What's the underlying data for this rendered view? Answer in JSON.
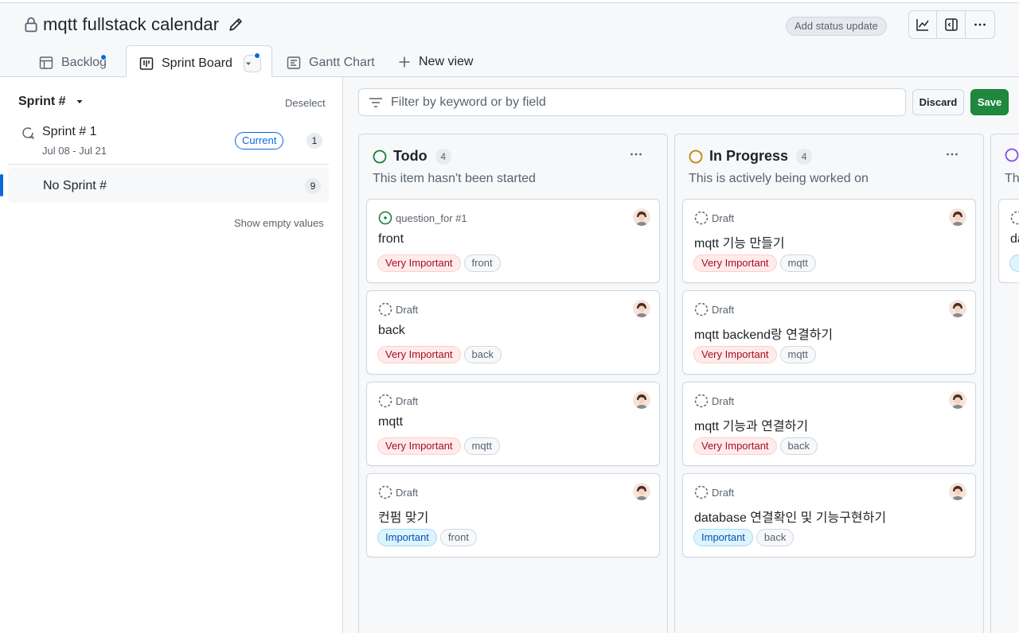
{
  "project": {
    "title": "mqtt fullstack calendar"
  },
  "header": {
    "status_button": "Add status update"
  },
  "tabs": [
    {
      "label": "Backlog"
    },
    {
      "label": "Sprint Board"
    },
    {
      "label": "Gantt Chart"
    },
    {
      "label": "New view"
    }
  ],
  "sidebar": {
    "field_label": "Sprint #",
    "deselect": "Deselect",
    "sprint": {
      "name": "Sprint # 1",
      "dates": "Jul 08 - Jul 21",
      "badge": "Current",
      "count": "1"
    },
    "no_sprint": {
      "name": "No Sprint #",
      "count": "9"
    },
    "show_empty": "Show empty values"
  },
  "filter": {
    "placeholder": "Filter by keyword or by field",
    "discard": "Discard",
    "save": "Save"
  },
  "columns": [
    {
      "title": "Todo",
      "count": "4",
      "description": "This item hasn't been started",
      "status_color": "#1a7f37",
      "cards": [
        {
          "meta": "question_for #1",
          "title": "front",
          "priority": "Very Important",
          "tag": "front"
        },
        {
          "meta": "Draft",
          "title": "back",
          "priority": "Very Important",
          "tag": "back"
        },
        {
          "meta": "Draft",
          "title": "mqtt",
          "priority": "Very Important",
          "tag": "mqtt"
        },
        {
          "meta": "Draft",
          "title": "컨펌 맞기",
          "priority": "Important",
          "tag": "front"
        }
      ]
    },
    {
      "title": "In Progress",
      "count": "4",
      "description": "This is actively being worked on",
      "status_color": "#bf8700",
      "cards": [
        {
          "meta": "Draft",
          "title": "mqtt 기능 만들기",
          "priority": "Very Important",
          "tag": "mqtt"
        },
        {
          "meta": "Draft",
          "title": "mqtt backend랑 연결하기",
          "priority": "Very Important",
          "tag": "mqtt"
        },
        {
          "meta": "Draft",
          "title": "mqtt 기능과 연결하기",
          "priority": "Very Important",
          "tag": "back"
        },
        {
          "meta": "Draft",
          "title": "database 연결확인 및 기능구현하기",
          "priority": "Important",
          "tag": "back"
        }
      ]
    },
    {
      "description": "Th",
      "card_title": "da",
      "status_color": "#8250df"
    }
  ],
  "colors": {
    "accent": "#0969da",
    "save": "#1f883d"
  },
  "icons": [
    "lock-icon",
    "pencil-icon",
    "graph-icon",
    "sidebar-icon",
    "kebab-icon",
    "table-icon",
    "board-icon",
    "gantt-icon",
    "plus-icon",
    "filter-icon",
    "iteration-icon",
    "avatar-icon"
  ]
}
